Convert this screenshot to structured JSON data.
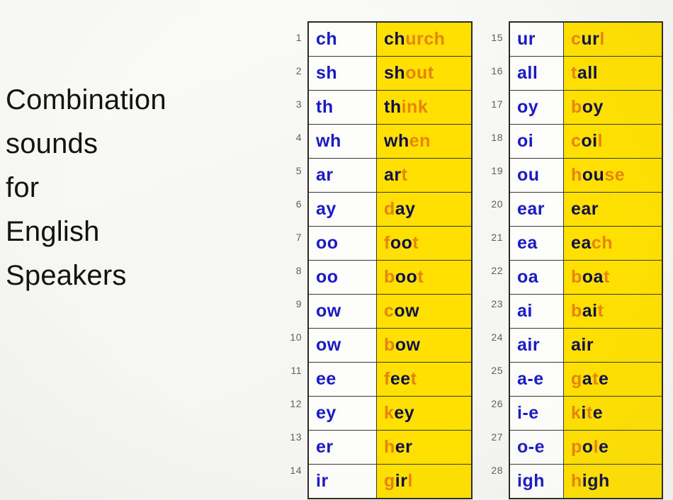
{
  "title": {
    "lines": [
      "Combination",
      "sounds",
      "for",
      "English",
      "Speakers"
    ],
    "full_text": "Combination sounds for English Speakers"
  },
  "colors": {
    "page_background": "#f7f7f5",
    "key_text": "#1a1ac4",
    "word_highlight_background": "#ffe000",
    "word_focus_letters": "#101044",
    "word_other_letters": "#e88400",
    "table_border": "#2b2b22",
    "row_number": "#5f5f5f"
  },
  "columns": {
    "left": {
      "header_note": "rows 1-14",
      "rows": [
        {
          "number": "1",
          "key": "ch",
          "word": "church",
          "segments": [
            {
              "text": "ch",
              "style": "dark"
            },
            {
              "text": "urch",
              "style": "accent"
            }
          ]
        },
        {
          "number": "2",
          "key": "sh",
          "word": "shout",
          "segments": [
            {
              "text": "sh",
              "style": "dark"
            },
            {
              "text": "out",
              "style": "accent"
            }
          ]
        },
        {
          "number": "3",
          "key": "th",
          "word": "think",
          "segments": [
            {
              "text": "th",
              "style": "dark"
            },
            {
              "text": "ink",
              "style": "accent"
            }
          ]
        },
        {
          "number": "4",
          "key": "wh",
          "word": "when",
          "segments": [
            {
              "text": "wh",
              "style": "dark"
            },
            {
              "text": "en",
              "style": "accent"
            }
          ]
        },
        {
          "number": "5",
          "key": "ar",
          "word": "art",
          "segments": [
            {
              "text": "ar",
              "style": "dark"
            },
            {
              "text": "t",
              "style": "accent"
            }
          ]
        },
        {
          "number": "6",
          "key": "ay",
          "word": "day",
          "segments": [
            {
              "text": "d",
              "style": "accent"
            },
            {
              "text": "ay",
              "style": "dark"
            }
          ]
        },
        {
          "number": "7",
          "key": "oo",
          "word": "foot",
          "segments": [
            {
              "text": "f",
              "style": "accent"
            },
            {
              "text": "oo",
              "style": "dark"
            },
            {
              "text": "t",
              "style": "accent"
            }
          ]
        },
        {
          "number": "8",
          "key": "oo",
          "word": "boot",
          "segments": [
            {
              "text": "b",
              "style": "accent"
            },
            {
              "text": "oo",
              "style": "dark"
            },
            {
              "text": "t",
              "style": "accent"
            }
          ]
        },
        {
          "number": "9",
          "key": "ow",
          "word": "cow",
          "segments": [
            {
              "text": "c",
              "style": "accent"
            },
            {
              "text": "ow",
              "style": "dark"
            }
          ]
        },
        {
          "number": "10",
          "key": "ow",
          "word": "bow",
          "segments": [
            {
              "text": "b",
              "style": "accent"
            },
            {
              "text": "ow",
              "style": "dark"
            }
          ]
        },
        {
          "number": "11",
          "key": "ee",
          "word": "feet",
          "segments": [
            {
              "text": "f",
              "style": "accent"
            },
            {
              "text": "ee",
              "style": "dark"
            },
            {
              "text": "t",
              "style": "accent"
            }
          ]
        },
        {
          "number": "12",
          "key": "ey",
          "word": "key",
          "segments": [
            {
              "text": "k",
              "style": "accent"
            },
            {
              "text": "ey",
              "style": "dark"
            }
          ]
        },
        {
          "number": "13",
          "key": "er",
          "word": "her",
          "segments": [
            {
              "text": "h",
              "style": "accent"
            },
            {
              "text": "er",
              "style": "dark"
            }
          ]
        },
        {
          "number": "14",
          "key": "ir",
          "word": "girl",
          "segments": [
            {
              "text": "g",
              "style": "accent"
            },
            {
              "text": "ir",
              "style": "dark"
            },
            {
              "text": "l",
              "style": "accent"
            }
          ]
        }
      ]
    },
    "right": {
      "header_note": "rows 15-28",
      "rows": [
        {
          "number": "15",
          "key": "ur",
          "word": "curl",
          "segments": [
            {
              "text": "c",
              "style": "accent"
            },
            {
              "text": "ur",
              "style": "dark"
            },
            {
              "text": "l",
              "style": "accent"
            }
          ]
        },
        {
          "number": "16",
          "key": "all",
          "word": "tall",
          "segments": [
            {
              "text": "t",
              "style": "accent"
            },
            {
              "text": "all",
              "style": "dark"
            }
          ]
        },
        {
          "number": "17",
          "key": "oy",
          "word": "boy",
          "segments": [
            {
              "text": "b",
              "style": "accent"
            },
            {
              "text": "oy",
              "style": "dark"
            }
          ]
        },
        {
          "number": "18",
          "key": "oi",
          "word": "coil",
          "segments": [
            {
              "text": "c",
              "style": "accent"
            },
            {
              "text": "oi",
              "style": "dark"
            },
            {
              "text": "l",
              "style": "accent"
            }
          ]
        },
        {
          "number": "19",
          "key": "ou",
          "word": "house",
          "segments": [
            {
              "text": "h",
              "style": "accent"
            },
            {
              "text": "ou",
              "style": "dark"
            },
            {
              "text": "se",
              "style": "accent"
            }
          ]
        },
        {
          "number": "20",
          "key": "ear",
          "word": "ear",
          "segments": [
            {
              "text": "ear",
              "style": "dark"
            }
          ]
        },
        {
          "number": "21",
          "key": "ea",
          "word": "each",
          "segments": [
            {
              "text": "ea",
              "style": "dark"
            },
            {
              "text": "ch",
              "style": "accent"
            }
          ]
        },
        {
          "number": "22",
          "key": "oa",
          "word": "boat",
          "segments": [
            {
              "text": "b",
              "style": "accent"
            },
            {
              "text": "oa",
              "style": "dark"
            },
            {
              "text": "t",
              "style": "accent"
            }
          ]
        },
        {
          "number": "23",
          "key": "ai",
          "word": "bait",
          "segments": [
            {
              "text": "b",
              "style": "accent"
            },
            {
              "text": "ai",
              "style": "dark"
            },
            {
              "text": "t",
              "style": "accent"
            }
          ]
        },
        {
          "number": "24",
          "key": "air",
          "word": "air",
          "segments": [
            {
              "text": "air",
              "style": "dark"
            }
          ]
        },
        {
          "number": "25",
          "key": "a-e",
          "word": "gate",
          "segments": [
            {
              "text": "g",
              "style": "accent"
            },
            {
              "text": "a",
              "style": "dark"
            },
            {
              "text": "t",
              "style": "accent"
            },
            {
              "text": "e",
              "style": "dark"
            }
          ]
        },
        {
          "number": "26",
          "key": "i-e",
          "word": "kite",
          "segments": [
            {
              "text": "k",
              "style": "accent"
            },
            {
              "text": "i",
              "style": "dark"
            },
            {
              "text": "t",
              "style": "accent"
            },
            {
              "text": "e",
              "style": "dark"
            }
          ]
        },
        {
          "number": "27",
          "key": "o-e",
          "word": "pole",
          "segments": [
            {
              "text": "p",
              "style": "accent"
            },
            {
              "text": "o",
              "style": "dark"
            },
            {
              "text": "l",
              "style": "accent"
            },
            {
              "text": "e",
              "style": "dark"
            }
          ]
        },
        {
          "number": "28",
          "key": "igh",
          "word": "high",
          "segments": [
            {
              "text": "h",
              "style": "accent"
            },
            {
              "text": "igh",
              "style": "dark"
            }
          ]
        }
      ]
    }
  }
}
